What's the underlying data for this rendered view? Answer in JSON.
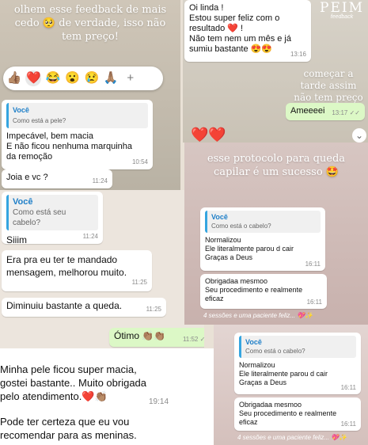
{
  "p1": {
    "caption": "olhem esse feedback de mais cedo 🥺 de verdade, isso não tem preço!",
    "reactions": [
      "👍🏽",
      "❤️",
      "😂",
      "😮",
      "😢",
      "🙏🏽",
      "+"
    ],
    "quote_who": "Você",
    "quote_text": "Como está a pele?",
    "reply_lines": [
      "Impecável, bem macia",
      "E não ficou nenhuma marquinha",
      "da remoção"
    ],
    "reply_time": "10:54",
    "joia": "Joia e vc ?",
    "joia_time": "11:24"
  },
  "p2": {
    "lines": [
      "Oi linda !",
      "Estou super feliz com o",
      "resultado ❤️ !",
      "Não tem nem um mês e já",
      "sumiu bastante 😍😍"
    ],
    "time": "13:16",
    "logo": "PEIM",
    "logo_sub": "feedback",
    "caption": "começar a tarde assim não tem preço 💖",
    "out_text": "Ameeeei",
    "out_time": "13:17 ✓✓",
    "hearts": "❤️❤️"
  },
  "p3": {
    "quote_who": "Você",
    "quote_text": "Como está seu cabelo?",
    "siiim": "Siiim",
    "siiim_time": "11:24",
    "msg": "Era pra eu ter te mandado mensagem, melhorou muito.",
    "msg_time": "11:25",
    "queda": "Diminuiu bastante a queda.",
    "queda_time": "11:25",
    "otimo": "Ótimo 👏🏽👏🏽",
    "otimo_time": "11:52 ✓✓"
  },
  "p4": {
    "caption": "esse protocolo para queda capilar é um sucesso 🤩",
    "quote_who": "Você",
    "quote_text": "Como está o cabelo?",
    "normal_lines": [
      "Normalizou",
      "Ele literalmente parou d cair",
      "Graças a Deus"
    ],
    "normal_time": "16:11",
    "obrig_lines": [
      "Obrigadaa mesmoo",
      "Seu procedimento e realmente",
      "eficaz"
    ],
    "obrig_time": "16:11",
    "footer": "4 sessões e uma paciente feliz... 💖✨"
  },
  "p5": {
    "quote_who": "Você",
    "quote_text": "Como está o cabelo?",
    "normal_lines": [
      "Normalizou",
      "Ele literalmente parou d cair",
      "Graças a Deus"
    ],
    "normal_time": "16:11",
    "obrig_lines": [
      "Obrigadaa mesmoo",
      "Seu procedimento e realmente",
      "eficaz"
    ],
    "obrig_time": "16:11",
    "footer": "4 sessões e uma paciente feliz... 💖✨"
  },
  "p6": {
    "lines": [
      "Minha pele ficou super macia,",
      "gostei bastante.. Muito obrigada",
      "pelo atendimento.❤️👏🏽"
    ],
    "time": "19:14",
    "lines2": [
      "Pode ter certeza que eu vou",
      "recomendar para as meninas."
    ]
  }
}
